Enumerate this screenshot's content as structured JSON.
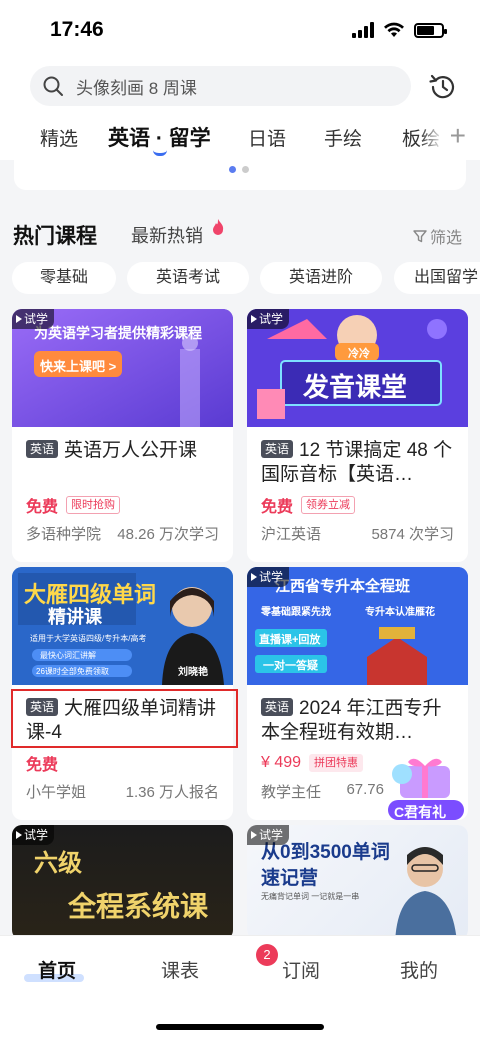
{
  "status": {
    "time": "17:46"
  },
  "search": {
    "placeholder": "头像刻画 8 周课"
  },
  "tabs": [
    "精选",
    "英语 · 留学",
    "日语",
    "手绘",
    "板绘"
  ],
  "tabs_plus": "+",
  "section": {
    "title": "热门课程",
    "subtitle": "最新热销",
    "filter": "筛选"
  },
  "chips": [
    "零基础",
    "英语考试",
    "英语进阶",
    "出国留学"
  ],
  "trial_label": "试学",
  "cards": [
    {
      "lang": "英语",
      "title": "英语万人公开课",
      "price": "免费",
      "price_tag": "限时抢购",
      "provider": "多语种学院",
      "stat": "48.26 万次学习",
      "thumb_text": [
        "为英语学习者提供精彩课程",
        "快来上课吧 >"
      ]
    },
    {
      "lang": "英语",
      "title": "12 节课搞定 48 个国际音标【英语…",
      "price": "免费",
      "price_tag": "领券立减",
      "provider": "沪江英语",
      "stat": "5874 次学习",
      "thumb_text": [
        "冷冷",
        "发音课堂"
      ]
    },
    {
      "lang": "英语",
      "title": "大雁四级单词精讲课-4",
      "price": "免费",
      "price_tag": "",
      "provider": "小午学姐",
      "stat": "1.36 万人报名",
      "thumb_text": [
        "大雁四级单词",
        "精讲课",
        "适用于大学英语四级/专升本/高考",
        "最快心词汇讲解",
        "26课时全部免费领取",
        "刘晓艳"
      ]
    },
    {
      "lang": "英语",
      "title": "2024 年江西专升本全程班有效期…",
      "price": "¥ 499",
      "price_tag": "拼团特惠",
      "provider": "教学主任",
      "stat": "67.76",
      "thumb_text": [
        "江西省专升本全程班",
        "零基础跟紧先找",
        "专升本认准雁花",
        "直播课+回放",
        "一对一答疑"
      ]
    },
    {
      "thumb_text": [
        "六级",
        "全程系统课"
      ]
    },
    {
      "thumb_text": [
        "从0到3500单词",
        "速记营",
        "无痛背记单词 一记就是一串"
      ]
    }
  ],
  "gift_text": "C君有礼",
  "nav": {
    "home": "首页",
    "schedule": "课表",
    "subscribe": "订阅",
    "mine": "我的",
    "badge": "2"
  },
  "colors": {
    "accent": "#3a6df0",
    "price": "#ec3b5a",
    "highlight": "#e02a2a"
  }
}
